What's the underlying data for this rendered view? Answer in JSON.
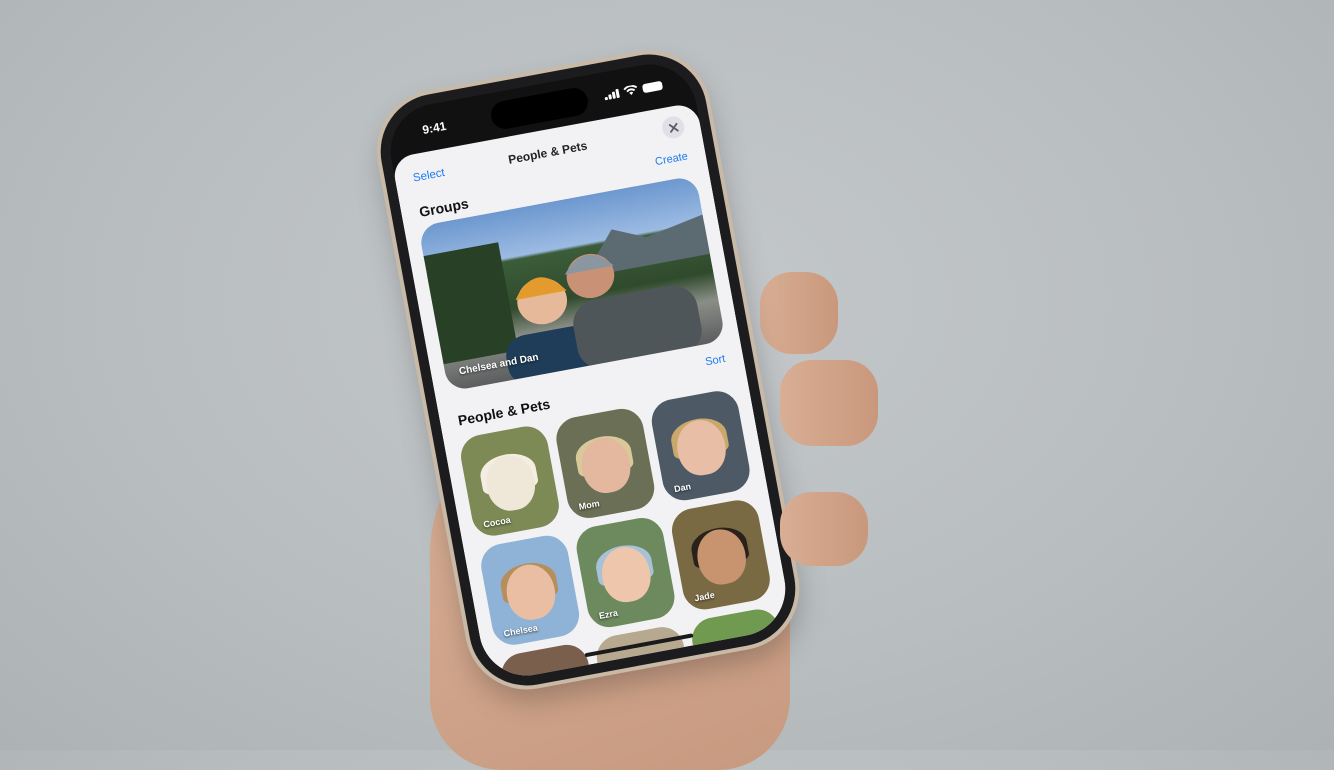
{
  "status": {
    "time": "9:41"
  },
  "nav": {
    "select": "Select",
    "title": "People & Pets"
  },
  "groups": {
    "title": "Groups",
    "action": "Create",
    "card_label": "Chelsea and Dan"
  },
  "people": {
    "title": "People & Pets",
    "action": "Sort",
    "tiles": [
      {
        "name": "Cocoa",
        "bg": "#7d8a55",
        "skin": "#efe7d8",
        "hair": "#f3ede2"
      },
      {
        "name": "Mom",
        "bg": "#6a6f55",
        "skin": "#e3b89e",
        "hair": "#d9c99a"
      },
      {
        "name": "Dan",
        "bg": "#4d5a66",
        "skin": "#e8bfa6",
        "hair": "#c9a86b"
      },
      {
        "name": "Chelsea",
        "bg": "#8fb3d6",
        "skin": "#e9bea3",
        "hair": "#b58e5c"
      },
      {
        "name": "Ezra",
        "bg": "#6c8a5e",
        "skin": "#eec6ab",
        "hair": "#a7c2d6"
      },
      {
        "name": "Jade",
        "bg": "#7a6a44",
        "skin": "#c89470",
        "hair": "#2b211b"
      },
      {
        "name": "",
        "bg": "#7a5f4c",
        "skin": "#d7a98c",
        "hair": "#5a4230"
      },
      {
        "name": "",
        "bg": "#b7a98f",
        "skin": "#d9b095",
        "hair": "#241c17"
      },
      {
        "name": "",
        "bg": "#6f9a4f",
        "skin": "#d6ab90",
        "hair": "#4a3a30"
      }
    ]
  }
}
